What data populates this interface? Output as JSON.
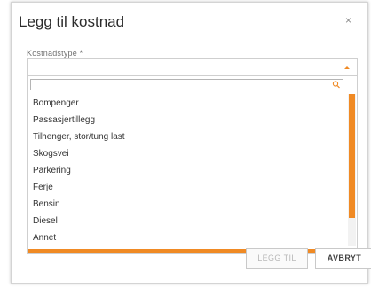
{
  "dialog": {
    "title": "Legg til kostnad",
    "close_label": "×"
  },
  "field": {
    "label": "Kostnadstype *",
    "selected_value": ""
  },
  "search": {
    "placeholder": "",
    "value": ""
  },
  "options": [
    "Bompenger",
    "Passasjertillegg",
    "Tilhenger, stor/tung last",
    "Skogsvei",
    "Parkering",
    "Ferje",
    "Bensin",
    "Diesel",
    "Annet"
  ],
  "buttons": {
    "add_label": "LEGG TIL",
    "cancel_label": "AVBRYT"
  },
  "colors": {
    "accent": "#f08a24",
    "border": "#cfcfcf",
    "disabled_text": "#b8b8b8"
  },
  "icons": {
    "close": "close-icon",
    "search": "search-icon",
    "dropdown_arrow": "chevron-up-icon"
  }
}
